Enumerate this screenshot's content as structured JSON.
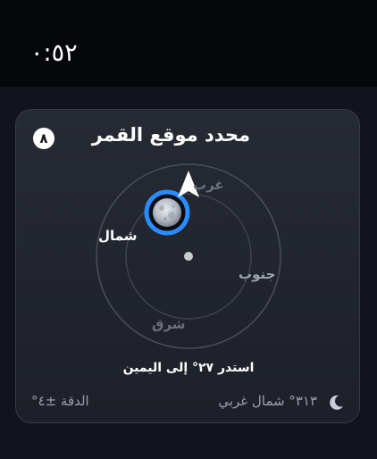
{
  "status_bar": {
    "time": "٠:٥٢"
  },
  "card": {
    "title": "محدد موقع القمر",
    "badge": "٨",
    "compass": {
      "north": "شمال",
      "west": "غرب",
      "south": "جنوب",
      "east": "شرق"
    },
    "instruction": "استدر ٢٧° إلى اليمين",
    "heading": "٣١٣° شمال غربي",
    "accuracy": "الدقة ±٤°"
  },
  "colors": {
    "accent_ring": "#2a8cff",
    "background": "#11141c",
    "card": "#23262e"
  },
  "icons": {
    "heading_icon": "crescent-moon-icon",
    "direction_icon": "navigation-arrow-icon",
    "moon_marker": "full-moon-icon"
  }
}
